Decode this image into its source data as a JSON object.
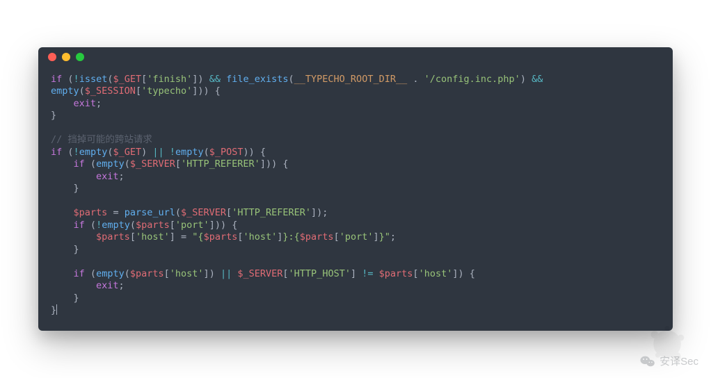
{
  "window": {
    "dots": {
      "red": "#ff5f56",
      "yellow": "#ffbd2e",
      "green": "#27c93f"
    }
  },
  "code": {
    "kw_if": "if",
    "op_not": "!",
    "fn_isset": "isset",
    "p_lparen": "(",
    "p_rparen": ")",
    "p_lbrack": "[",
    "p_rbrack": "]",
    "p_lbrace": "{",
    "p_rbrace": "}",
    "p_semi": ";",
    "p_dot": ".",
    "p_comma": ",",
    "p_eq": "=",
    "p_colon": ":",
    "p_pipe": "||",
    "p_amp": "&&",
    "p_neq": "!=",
    "var_get": "$_GET",
    "var_session": "$_SESSION",
    "var_server": "$_SERVER",
    "var_post": "$_POST",
    "var_parts": "$parts",
    "str_finish": "'finish'",
    "str_typecho": "'typecho'",
    "str_config": "'/config.inc.php'",
    "str_referer": "'HTTP_REFERER'",
    "str_port": "'port'",
    "str_host": "'host'",
    "str_httphost": "'HTTP_HOST'",
    "const_root": "__TYPECHO_ROOT_DIR__",
    "fn_file_exists": "file_exists",
    "fn_empty": "empty",
    "fn_parse_url": "parse_url",
    "kw_exit": "exit",
    "comment_cn": "// 挡掉可能的跨站请求",
    "interp_open": "\"{",
    "interp_mid1": "}:{",
    "interp_close": "}\"",
    "space": " ",
    "indent1": "    ",
    "indent2": "        ",
    "indent3": "            "
  },
  "watermark": {
    "label": "安译Sec"
  }
}
